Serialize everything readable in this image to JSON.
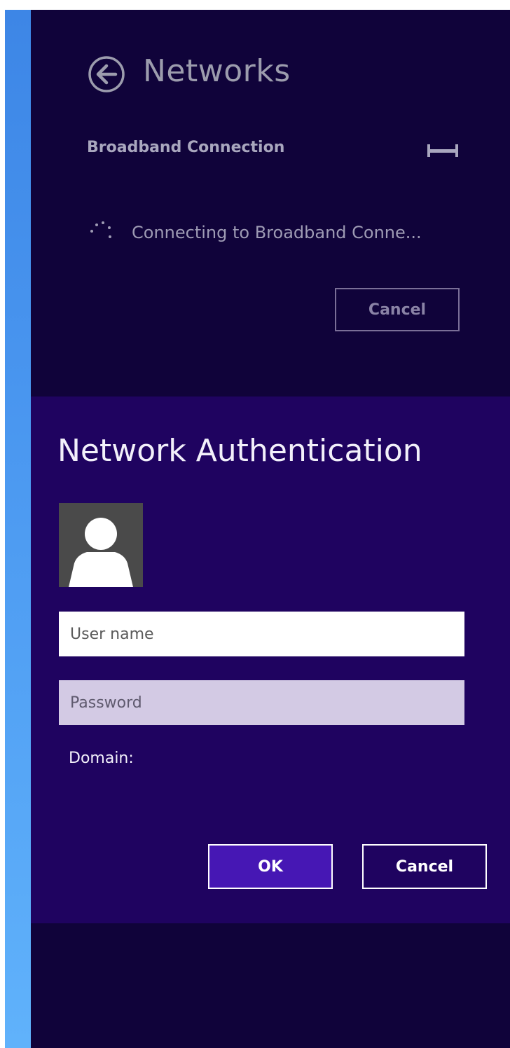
{
  "networks": {
    "title": "Networks",
    "back_icon": "back-arrow-circle-icon",
    "connection_name": "Broadband Connection",
    "connection_icon": "ethernet-icon",
    "status_text": "Connecting to Broadband Conne...",
    "status_icon": "spinner-icon",
    "cancel_label": "Cancel"
  },
  "auth": {
    "title": "Network Authentication",
    "avatar_icon": "user-avatar-icon",
    "username_placeholder": "User name",
    "password_placeholder": "Password",
    "domain_label": "Domain:",
    "ok_label": "OK",
    "cancel_label": "Cancel"
  },
  "colors": {
    "accent_bar": "#4a97f0",
    "networks_bg": "#10033a",
    "auth_bg": "#1f0360",
    "ok_button_bg": "#4617b4"
  }
}
